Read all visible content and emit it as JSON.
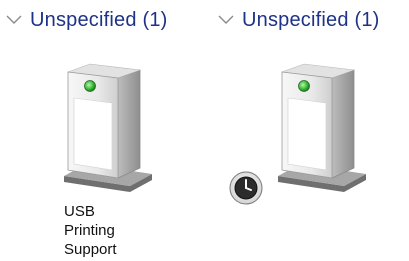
{
  "groups": [
    {
      "header": "Unspecified (1)",
      "device": {
        "label": "USB\nPrinting\nSupport",
        "icon": "printer-device-icon",
        "status_overlay": null
      }
    },
    {
      "header": "Unspecified (1)",
      "device": {
        "label": "",
        "icon": "printer-device-icon",
        "status_overlay": "clock-icon"
      }
    }
  ],
  "colors": {
    "header_text": "#1e3287",
    "status_light": "#3fbf3a"
  }
}
